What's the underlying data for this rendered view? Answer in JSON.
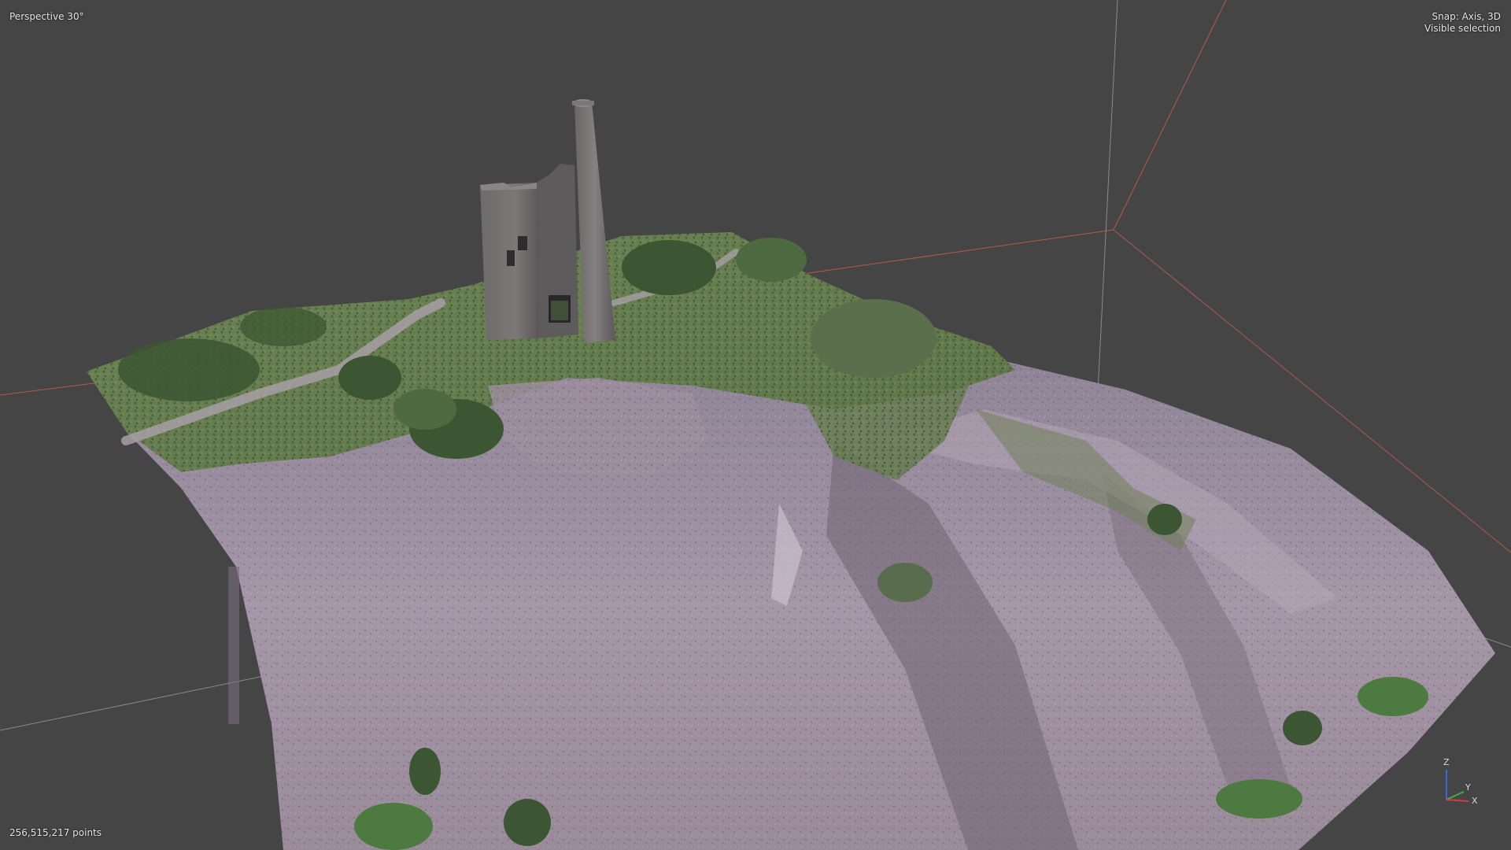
{
  "viewport": {
    "view_label": "Perspective 30°",
    "snap_label": "Snap: Axis, 3D",
    "selection_label": "Visible selection",
    "point_count": "256,515,217 points",
    "background_color": "#454545",
    "bounding_box_color": "#b05a4e",
    "grid_line_color": "#8a8a8a"
  },
  "gizmo": {
    "z_label": "Z",
    "y_label": "Y",
    "x_label": "X",
    "x_color": "#d04040",
    "y_color": "#3cb043",
    "z_color": "#3a6ad8"
  },
  "scene": {
    "description_icon": "point-cloud-terrain",
    "structures": [
      "engine-house",
      "chimney-stack"
    ]
  }
}
